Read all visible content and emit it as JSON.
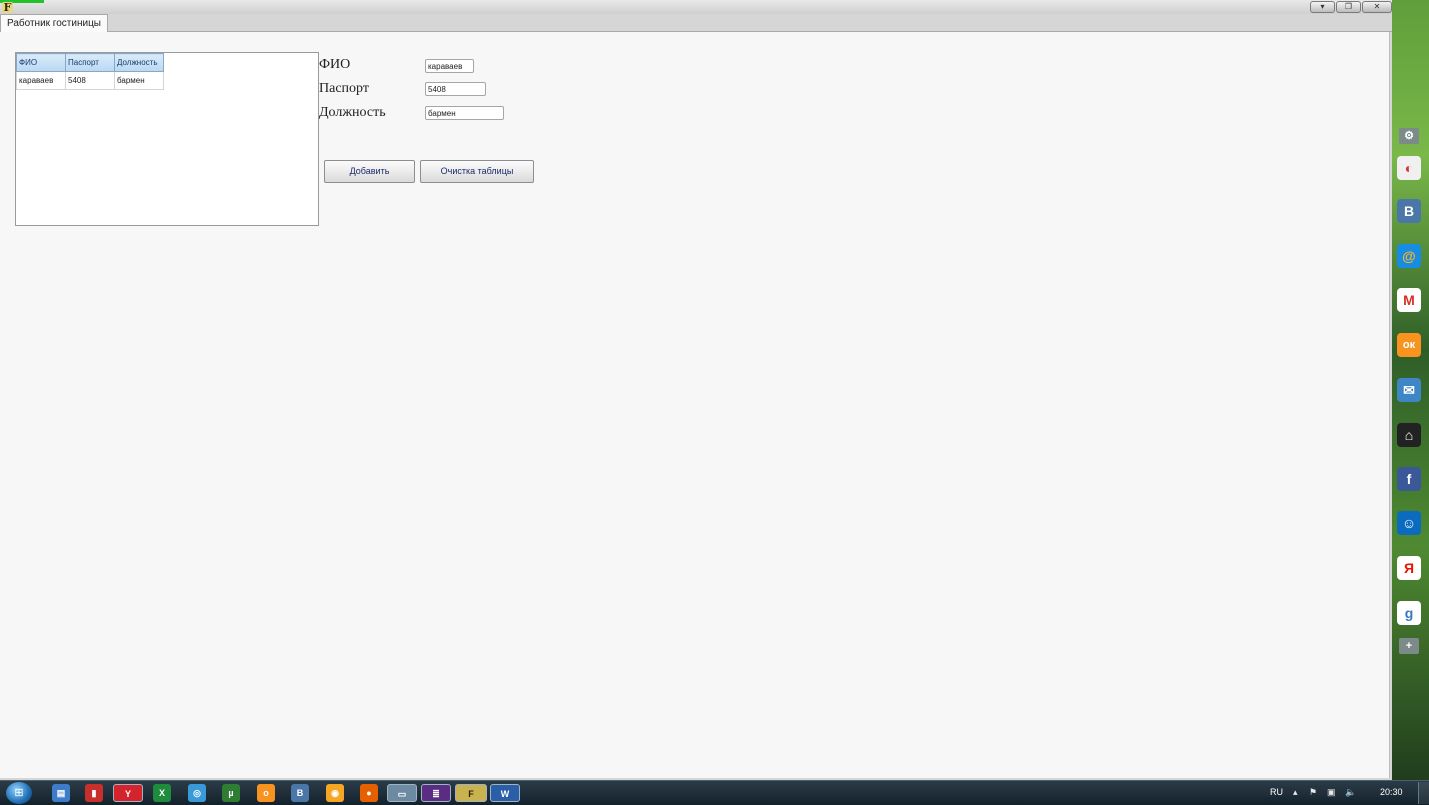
{
  "window": {
    "tab_label": "Работник гостиницы",
    "app_logo_text": "F"
  },
  "grid": {
    "columns": [
      "ФИО",
      "Паспорт",
      "Должность"
    ],
    "rows": [
      [
        "караваев",
        "5408",
        "бармен"
      ]
    ]
  },
  "form": {
    "fio_label": "ФИО",
    "fio_value": "караваев",
    "passport_label": "Паспорт",
    "passport_value": "5408",
    "position_label": "Должность",
    "position_value": "бармен",
    "add_button": "Добавить",
    "clear_button": "Очистка таблицы"
  },
  "sidebar": {
    "items": [
      {
        "name": "settings-icon",
        "glyph": "⚙",
        "color": "#7c8a8a"
      },
      {
        "name": "picasa-icon",
        "glyph": "◐",
        "color": "#e9e9e9"
      },
      {
        "name": "vk-icon",
        "glyph": "В",
        "color": "#4a76a8"
      },
      {
        "name": "mailru-icon",
        "glyph": "@",
        "color": "#168de2"
      },
      {
        "name": "gmail-icon",
        "glyph": "M",
        "color": "#ffffff"
      },
      {
        "name": "odnoklassniki-icon",
        "glyph": "ок",
        "color": "#f7931e"
      },
      {
        "name": "mail-envelope-icon",
        "glyph": "✉",
        "color": "#3f86c7"
      },
      {
        "name": "mail-box-icon",
        "glyph": "⌂",
        "color": "#222222"
      },
      {
        "name": "facebook-icon",
        "glyph": "f",
        "color": "#3b5998"
      },
      {
        "name": "moi-mir-icon",
        "glyph": "☺",
        "color": "#0b6bbf"
      },
      {
        "name": "yandex-icon",
        "glyph": "Я",
        "color": "#ffffff"
      },
      {
        "name": "google-plus-icon",
        "glyph": "g",
        "color": "#ffffff"
      },
      {
        "name": "add-icon",
        "glyph": "+",
        "color": "#7c8a8a"
      }
    ]
  },
  "taskbar": {
    "language": "RU",
    "clock": "20:30"
  }
}
